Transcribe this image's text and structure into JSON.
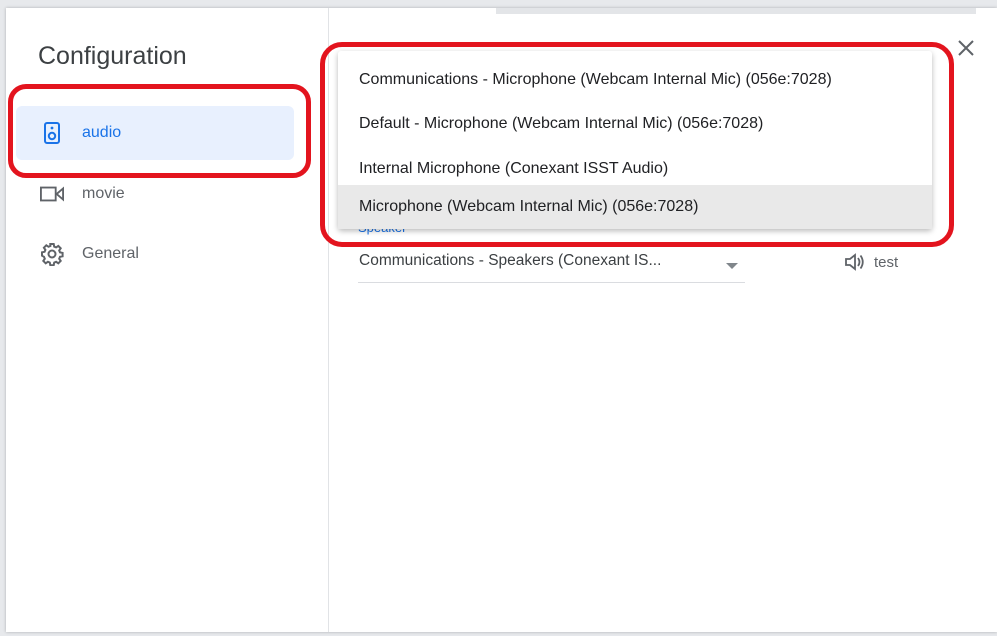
{
  "dialog": {
    "title": "Configuration"
  },
  "sidebar": {
    "items": [
      {
        "label": "audio",
        "icon": "speaker-icon",
        "active": true
      },
      {
        "label": "movie",
        "icon": "videocam-icon",
        "active": false
      },
      {
        "label": "General",
        "icon": "gear-icon",
        "active": false
      }
    ]
  },
  "audio": {
    "speaker_heading": "Speaker",
    "speaker_value": "Communications - Speakers (Conexant IS...",
    "test_label": "test"
  },
  "microphone_dropdown": {
    "options": [
      "Communications - Microphone (Webcam Internal Mic) (056e:7028)",
      "Default - Microphone (Webcam Internal Mic) (056e:7028)",
      "Internal Microphone (Conexant ISST Audio)",
      "Microphone (Webcam Internal Mic) (056e:7028)"
    ],
    "selected_index": 3
  },
  "colors": {
    "accent": "#1a73e8",
    "active_nav_bg": "#e8f0fe",
    "annotation": "#e3141e",
    "selected_option_bg": "#e9e9e9"
  }
}
